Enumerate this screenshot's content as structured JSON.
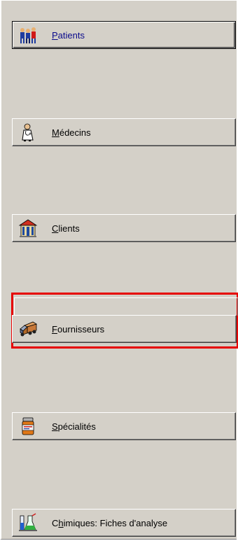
{
  "nav": {
    "items": [
      {
        "label": "Patients",
        "mnemonic": "P",
        "rest": "atients",
        "icon": "people-group-icon"
      },
      {
        "label": "Médecins",
        "mnemonic": "M",
        "rest": "édecins",
        "icon": "doctor-icon"
      },
      {
        "label": "Clients",
        "mnemonic": "C",
        "rest": "lients",
        "icon": "building-icon"
      },
      {
        "label": "Fournisseurs",
        "mnemonic": "F",
        "rest": "ournisseurs",
        "icon": "delivery-truck-icon"
      },
      {
        "label": "Spécialités",
        "mnemonic": "S",
        "rest": "pécialités",
        "icon": "medicine-bottle-icon"
      },
      {
        "label": "Chimiques: Fiches d'analyse",
        "pre": "C",
        "mnemonic": "h",
        "rest": "imiques: Fiches d'analyse",
        "icon": "lab-flask-icon"
      }
    ]
  },
  "colors": {
    "panel": "#d4d0c8",
    "focus_outline": "#e60000",
    "selected_label": "#0a0a8c"
  }
}
